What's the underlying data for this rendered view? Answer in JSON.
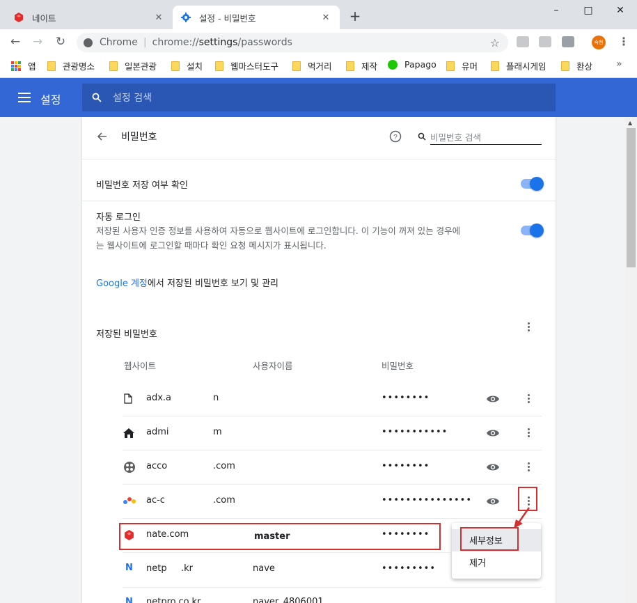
{
  "browser": {
    "tabs": [
      {
        "title": "네이트"
      },
      {
        "title": "설정 - 비밀번호"
      }
    ],
    "new_tab": "+",
    "window_controls": {
      "minimize": "–",
      "maximize": "□",
      "close": "✕"
    },
    "omnibox": {
      "site": "Chrome",
      "separator": "|",
      "url_prefix": "chrome://",
      "url_path": "settings",
      "url_rest": "/passwords"
    },
    "avatar_text": "숙현",
    "bookmarks": [
      "앱",
      "관광명소",
      "일본관광",
      "설치",
      "웹마스터도구",
      "먹거리",
      "제작",
      "Papago",
      "유머",
      "플래시게임",
      "환상"
    ],
    "bookmarks_more": "»"
  },
  "header": {
    "title": "설정",
    "search_placeholder": "설정 검색"
  },
  "page": {
    "title": "비밀번호",
    "search_placeholder": "비밀번호 검색",
    "offer_save": {
      "label": "비밀번호 저장 여부 확인",
      "enabled": true
    },
    "auto_signin": {
      "title": "자동 로그인",
      "description_line1": "저장된 사용자 인증 정보를 사용하여 자동으로 웹사이트에 로그인합니다. 이 기능이 꺼져 있는 경우에",
      "description_line2": "는 웹사이트에 로그인할 때마다 확인 요청 메시지가 표시됩니다.",
      "enabled": true
    },
    "google_link": "Google 계정",
    "google_link_rest": "에서 저장된 비밀번호 보기 및 관리",
    "saved_title": "저장된 비밀번호",
    "columns": {
      "website": "웹사이트",
      "username": "사용자이름",
      "password": "비밀번호"
    },
    "rows": [
      {
        "site": "adx.a",
        "site_tail": "n",
        "user": "",
        "password": "••••••••",
        "icon": "file-icon"
      },
      {
        "site": "admi",
        "site_tail": "m",
        "user": "",
        "password": "•••••••••••",
        "icon": "home-icon"
      },
      {
        "site": "acco",
        "site_tail": ".com",
        "user": "",
        "password": "••••••••",
        "icon": "site-favicon"
      },
      {
        "site": "ac-c",
        "site_tail": ".com",
        "user": "",
        "password": "•••••••••••••••",
        "icon": "site-favicon"
      },
      {
        "site": "nate.com",
        "site_tail": "",
        "user": "master",
        "password": "••••••••",
        "icon": "nate-favicon"
      },
      {
        "site": "netp",
        "site_tail": ".kr",
        "user": "nave",
        "password": "•••••••••",
        "icon": "naver-favicon"
      }
    ],
    "partial_row": {
      "site": "netpro.co.kr",
      "user": "naver_4806001"
    }
  },
  "context_menu": {
    "items": [
      "세부정보",
      "제거"
    ]
  },
  "colors": {
    "header": "#3367d6",
    "accent": "#1a73e8",
    "highlight_red": "#d32f2f",
    "nate_red": "#e32b2b",
    "naver_blue": "#1ec800"
  }
}
